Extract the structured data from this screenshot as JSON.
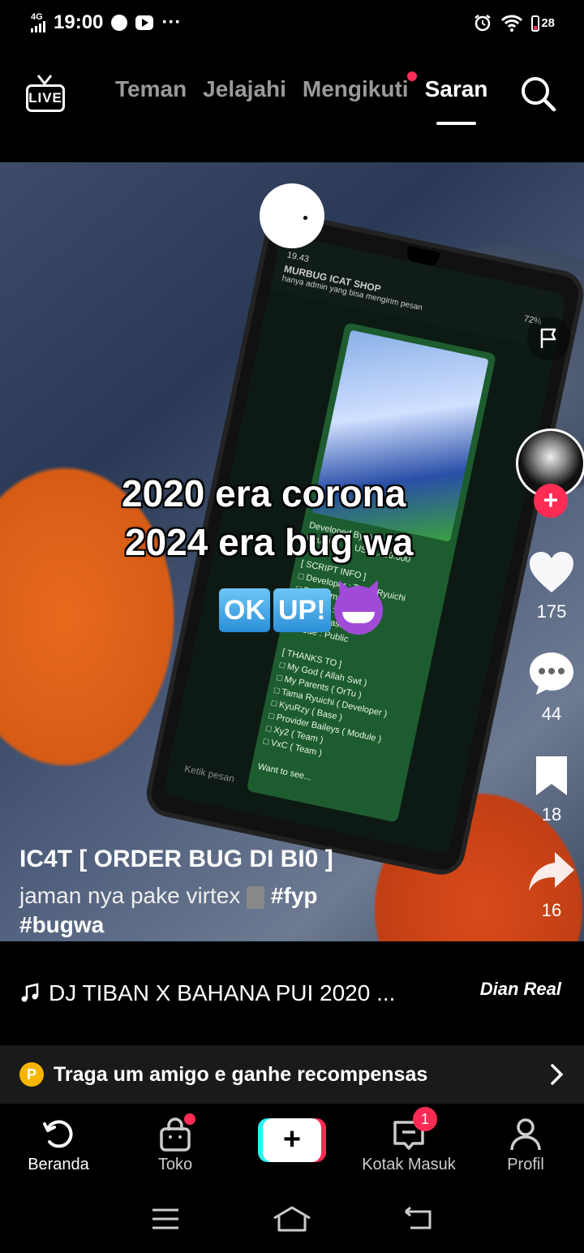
{
  "status_bar": {
    "network": "4G",
    "time": "19:00",
    "more": "···",
    "battery": "28"
  },
  "top_nav": {
    "live_label": "LIVE",
    "tabs": [
      {
        "label": "Teman"
      },
      {
        "label": "Jelajahi"
      },
      {
        "label": "Mengikuti"
      },
      {
        "label": "Saran"
      }
    ],
    "active_tab": "Saran"
  },
  "video": {
    "overlay_line1": "2020 era corona",
    "overlay_line2": "2024 era bug wa",
    "overlay_ok": "OK",
    "overlay_up": "UP!",
    "phone_chat_title": "MURBUG ICAT SHOP",
    "phone_chat_subtitle": "hanya admin yang bisa mengirim pesan",
    "phone_time": "19.43",
    "phone_battery": "72%",
    "phone_chat_text": "Developed By Tama\nRyuichi        US$1.000.000\n\n[ SCRIPT INFO ]\n□ Developer : Tama Ryuichi\n□ Bot Name : Infinity\n□ Version : 1.0.0\n□ Type : Case\n□ Mode : Public\n\n[ THANKS TO ]\n□ My God ( Allah Swt )\n□ My Parents ( OrTu )\n□ Tama Ryuichi ( Developer )\n□ KyuRzy ( Base )\n□ Provider Baileys ( Module )\n□ Xy2 ( Team )\n□ VxC ( Team )\n\nWant to see...",
    "phone_input_placeholder": "Ketik pesan"
  },
  "actions": {
    "like_count": "175",
    "comment_count": "44",
    "save_count": "18",
    "share_count": "16",
    "follow_symbol": "+"
  },
  "caption": {
    "author": "IC4T [ ORDER BUG DI BI0 ]",
    "description": "jaman nya pake virtex",
    "hashtag1": "#fyp",
    "hashtag2": "#bugwa",
    "music": "DJ TIBAN X BAHANA PUI 2020 ...",
    "music_credit": "Dian Real"
  },
  "banner": {
    "coin": "P",
    "text": "Traga um amigo e ganhe recompensas"
  },
  "bottom_nav": {
    "items": [
      {
        "label": "Beranda"
      },
      {
        "label": "Toko"
      },
      {
        "label": ""
      },
      {
        "label": "Kotak Masuk"
      },
      {
        "label": "Profil"
      }
    ],
    "create_symbol": "+",
    "inbox_badge": "1"
  },
  "colors": {
    "accent": "#fe2c55",
    "create_cyan": "#25f4ee",
    "coin": "#f7b500",
    "inactive_tab": "#9a9a9a"
  }
}
